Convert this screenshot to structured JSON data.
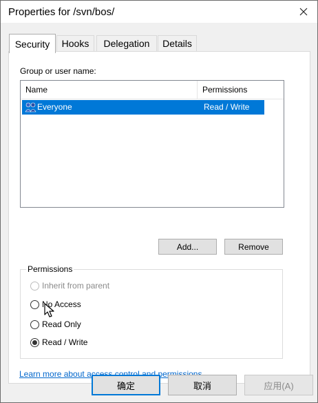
{
  "window": {
    "title": "Properties for /svn/bos/"
  },
  "tabs": [
    {
      "label": "Security",
      "active": true
    },
    {
      "label": "Hooks",
      "active": false
    },
    {
      "label": "Delegation",
      "active": false
    },
    {
      "label": "Details",
      "active": false
    }
  ],
  "security": {
    "group_label": "Group or user name:",
    "columns": {
      "name": "Name",
      "permissions": "Permissions"
    },
    "rows": [
      {
        "name": "Everyone",
        "permissions": "Read / Write",
        "selected": true,
        "icon": "users-group-icon"
      }
    ],
    "add_label": "Add...",
    "remove_label": "Remove",
    "permissions_legend": "Permissions",
    "options": [
      {
        "label": "Inherit from parent",
        "checked": false,
        "disabled": true
      },
      {
        "label": "No Access",
        "checked": false,
        "disabled": false
      },
      {
        "label": "Read Only",
        "checked": false,
        "disabled": false
      },
      {
        "label": "Read / Write",
        "checked": true,
        "disabled": false
      }
    ],
    "learn_more": "Learn more about access control and permissions"
  },
  "footer": {
    "ok_label": "确定",
    "cancel_label": "取消",
    "apply_label": "应用(A)"
  },
  "colors": {
    "selection": "#0078d7",
    "link": "#0066cc",
    "panel_bg": "#ffffff",
    "dialog_bg": "#f0f0f0"
  }
}
